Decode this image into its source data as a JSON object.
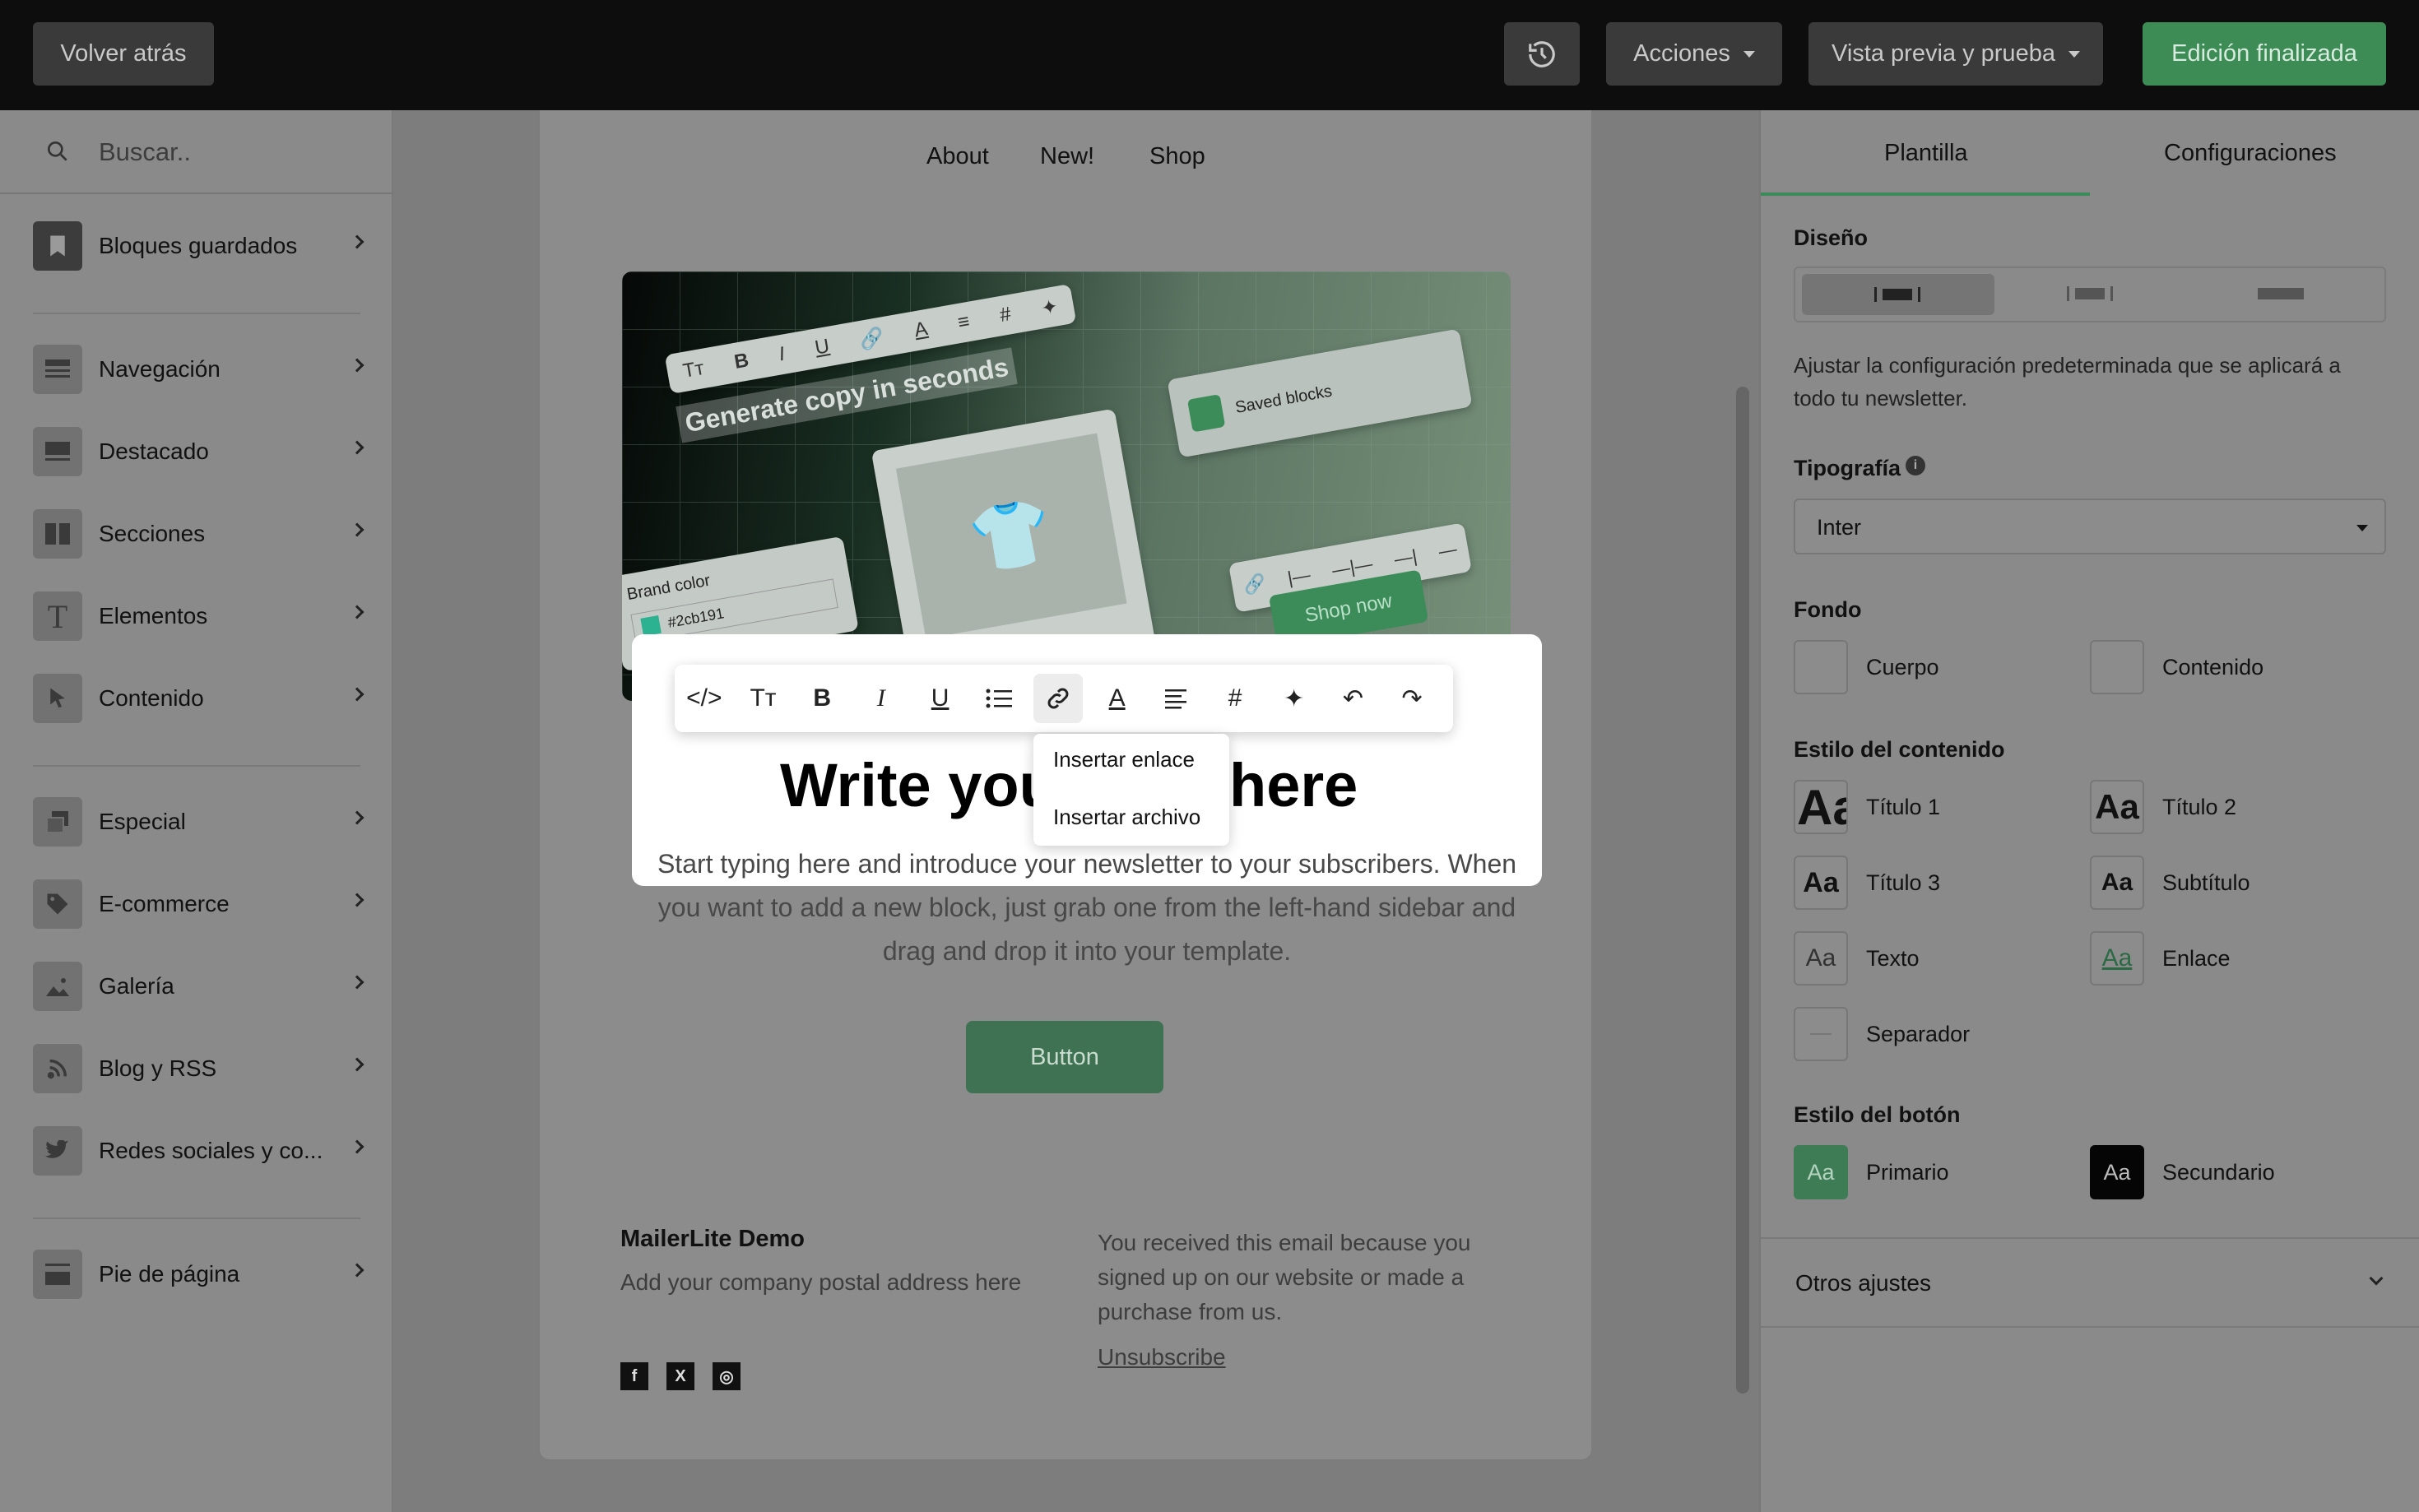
{
  "topbar": {
    "back_label": "Volver atrás",
    "actions_label": "Acciones",
    "preview_label": "Vista previa y prueba",
    "done_label": "Edición finalizada"
  },
  "sidebar": {
    "search_placeholder": "Buscar..",
    "items": [
      {
        "label": "Bloques guardados",
        "icon": "bookmark-icon"
      },
      {
        "label": "Navegación",
        "icon": "navigation-icon"
      },
      {
        "label": "Destacado",
        "icon": "featured-icon"
      },
      {
        "label": "Secciones",
        "icon": "sections-icon"
      },
      {
        "label": "Elementos",
        "icon": "text-icon"
      },
      {
        "label": "Contenido",
        "icon": "cursor-icon"
      },
      {
        "label": "Especial",
        "icon": "special-icon"
      },
      {
        "label": "E-commerce",
        "icon": "tag-icon"
      },
      {
        "label": "Galería",
        "icon": "image-icon"
      },
      {
        "label": "Blog y RSS",
        "icon": "rss-icon"
      },
      {
        "label": "Redes sociales y co...",
        "icon": "twitter-icon"
      },
      {
        "label": "Pie de página",
        "icon": "footer-icon"
      }
    ]
  },
  "canvas": {
    "nav": [
      "About",
      "New!",
      "Shop"
    ],
    "hero": {
      "generate_text": "Generate copy in seconds",
      "saved_blocks": "Saved blocks",
      "brand_color_label": "Brand color",
      "brand_color_value": "#2cb191",
      "shop_now": "Shop now"
    },
    "headline_left": "Write you",
    "headline_right": "here",
    "paragraph": "Start typing here and introduce your newsletter to your subscribers. When you want to add a new block, just grab one from the left-hand sidebar and drag and drop it into your template.",
    "button_label": "Button",
    "footer": {
      "company": "MailerLite Demo",
      "address": "Add your company postal address here",
      "note": "You received this email because you signed up on our website or made a purchase from us.",
      "unsubscribe": "Unsubscribe"
    }
  },
  "link_menu": {
    "insert_link": "Insertar enlace",
    "insert_file": "Insertar archivo"
  },
  "right_panel": {
    "tabs": [
      "Plantilla",
      "Configuraciones"
    ],
    "design_label": "Diseño",
    "design_help": "Ajustar la configuración predeterminada que se aplicará a todo tu newsletter.",
    "typography_label": "Tipografía",
    "typography_value": "Inter",
    "background_label": "Fondo",
    "bg_body": "Cuerpo",
    "bg_content": "Contenido",
    "content_style_label": "Estilo del contenido",
    "styles": {
      "title1": "Título 1",
      "title2": "Título 2",
      "title3": "Título 3",
      "subtitle": "Subtítulo",
      "text": "Texto",
      "link": "Enlace",
      "separator": "Separador"
    },
    "aa": "Aa",
    "button_style_label": "Estilo del botón",
    "primary": "Primario",
    "secondary": "Secundario",
    "other_settings": "Otros ajustes"
  },
  "colors": {
    "accent": "#3f8b5c",
    "done_button": "#3d8b55",
    "topbar": "#0d0d0d"
  }
}
